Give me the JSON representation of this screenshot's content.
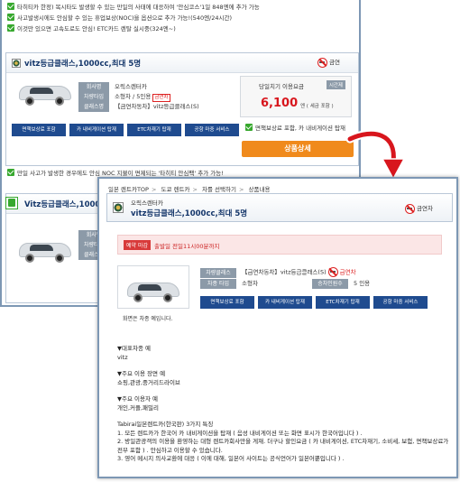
{
  "list_page": {
    "top_notices": [
      "타히티카 한정) 복시타도 발생할 수 있는 만일의 사태에 대응하여 '안심코스'1일 848엔에 추가 가능",
      "사고발생시에도 안심할 수 있는 휴업보상(NOC)을 옵션으로 추가 가능!(540엔/24시간)",
      "이것만 있으면 고속도로도 안심! ETC카드 렌탈 실시중(324엔~)"
    ],
    "card1": {
      "title": "vitz등급클래스,1000cc,최대 5명",
      "no_smoking": "금연",
      "spec_labels": [
        "회사명",
        "차량타입",
        "클래스명"
      ],
      "company": "오릭스렌터카",
      "car_type": "소형차 / 5인용",
      "no_smoking_tag": "금연차",
      "class_name": "【금연차동차】vitz등급클래스(S)",
      "price_label": "당일치기 이용요금",
      "price_tag": "시간제",
      "price": "6,100",
      "price_unit": "엔 ( 세금 포함 )",
      "feature_buttons": [
        "면책보상료 포함",
        "카 내비게이션 탑재",
        "ETC차재기 탑재",
        "공항 마중 서비스"
      ],
      "included_note": "면책보상료 포함, 카 내비게이션 탑재",
      "detail_button": "상품상세",
      "bottom_notice": "만일 사고가 발생한 경우에도 안심 NOC 지불이 면제되는 '타히티 안심팩' 추가 가능!"
    },
    "card2": {
      "title": "Vitz등급클래스,1000~",
      "spec_labels": [
        "회사명",
        "차량타입",
        "클래스명"
      ]
    }
  },
  "detail_page": {
    "breadcrumb": [
      "일본 렌트카TOP",
      "도쿄 렌트카",
      "차를 선택하기",
      "상품내용"
    ],
    "company": "오릭스렌터카",
    "title": "vitz등급클래스,1000cc,최대 5명",
    "no_smoking": "금연차",
    "deadline_tag": "예약 마감",
    "deadline_text": "출발일 전일11시00분까지",
    "spec_labels": [
      "차량클래스",
      "차종 타입",
      "승차인원수"
    ],
    "class_name": "【금연차동차】vitz등급클래스(S)",
    "no_smoking_tag": "금연차",
    "car_type": "소형차",
    "capacity": "5 인용",
    "feature_buttons": [
      "면책보상료 포함",
      "카 내비게이션 탑재",
      "ETC차재기 탑재",
      "공항 마중 서비스"
    ],
    "photo_caption": "화면은 차종 예입니다.",
    "desc_blocks": [
      {
        "head": "▼대표차종 예",
        "body": "vitz"
      },
      {
        "head": "▼주요 이용 장면 예",
        "body": "쇼핑,관광,중거리드라이브"
      },
      {
        "head": "▼주요 이용자 예",
        "body": "개인,커플,패밀리"
      }
    ],
    "features_title": "Tabirai일본렌트카(한국판) 3가지 특징",
    "features": [
      "1. 모든 렌트카가 한국어 카 내비게이션을 탑재 ( 음성 내비게이션 또는 화면 표시가 한국어입니다 ) .",
      "2. 방일관광객의 이용을 환영하는 대형 렌트카회사만을 게재. 더구나 할인요금 ( 카 내비게이션, ETC차재기, 소비세, 보험, 면책보상료가 전부 포함 ) . 안심하고 이용할 수 있습니다.",
      "3. 영어 메시지 의사교환에 대응 ( 이에 대해, 일본어 사이트는 공식언어가 일본어뿐입니다 ) ."
    ]
  },
  "colors": {
    "accent": "#1f4b8f",
    "price": "#d8161d",
    "detail_button": "#f08a1c",
    "arrow": "#d8161d"
  }
}
